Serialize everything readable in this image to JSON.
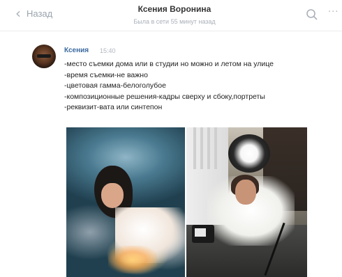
{
  "header": {
    "back_label": "Назад",
    "contact_name": "Ксения Воронина",
    "status": "Была в сети 55 минут назад"
  },
  "message": {
    "author": "Ксения",
    "time": "15:40",
    "lines": [
      "-место съемки дома или в студии но можно и летом на улице",
      "-время съемки-не важно",
      "-цветовая гамма-белоголубое",
      "-композиционные решения-кадры сверху и сбоку,портреты",
      "-реквизит-вата или синтепон"
    ]
  },
  "icons": {
    "back": "chevron-left-icon",
    "search": "search-icon",
    "more": "more-horizontal-icon"
  },
  "colors": {
    "author_link": "#3b6aa0",
    "muted": "#aab1b9",
    "text": "#222222"
  }
}
